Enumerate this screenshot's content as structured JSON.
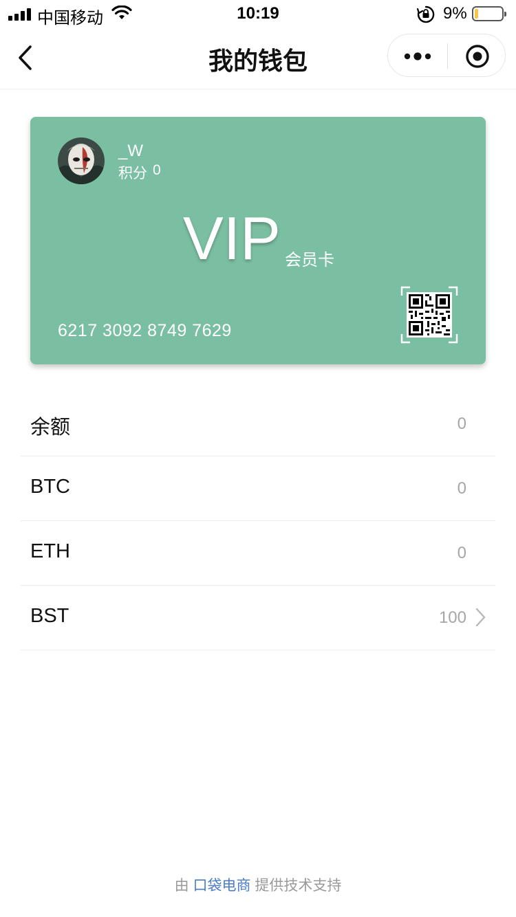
{
  "status_bar": {
    "carrier": "中国移动",
    "time": "10:19",
    "battery_percent": "9%",
    "battery_level": 0.09,
    "icons": [
      "signal-icon",
      "wifi-icon",
      "orientation-lock-icon",
      "battery-icon"
    ]
  },
  "nav": {
    "title": "我的钱包",
    "back_icon": "chevron-left-icon",
    "more_icon": "more-dots-icon",
    "close_icon": "target-close-icon"
  },
  "card": {
    "username": "_W",
    "points_label": "积分",
    "points_value": "0",
    "vip_label": "VIP",
    "vip_sub": "会员卡",
    "card_number": "6217 3092 8749 7629",
    "background_color": "#7bbfa2",
    "qr_icon": "qr-code-icon"
  },
  "assets": [
    {
      "label": "余额",
      "value": "0",
      "has_arrow": false
    },
    {
      "label": "BTC",
      "value": "0",
      "has_arrow": false
    },
    {
      "label": "ETH",
      "value": "0",
      "has_arrow": false
    },
    {
      "label": "BST",
      "value": "100",
      "has_arrow": true
    }
  ],
  "footer": {
    "prefix": "由",
    "brand": "口袋电商",
    "suffix": "提供技术支持",
    "brand_color": "#4a7cc7"
  }
}
